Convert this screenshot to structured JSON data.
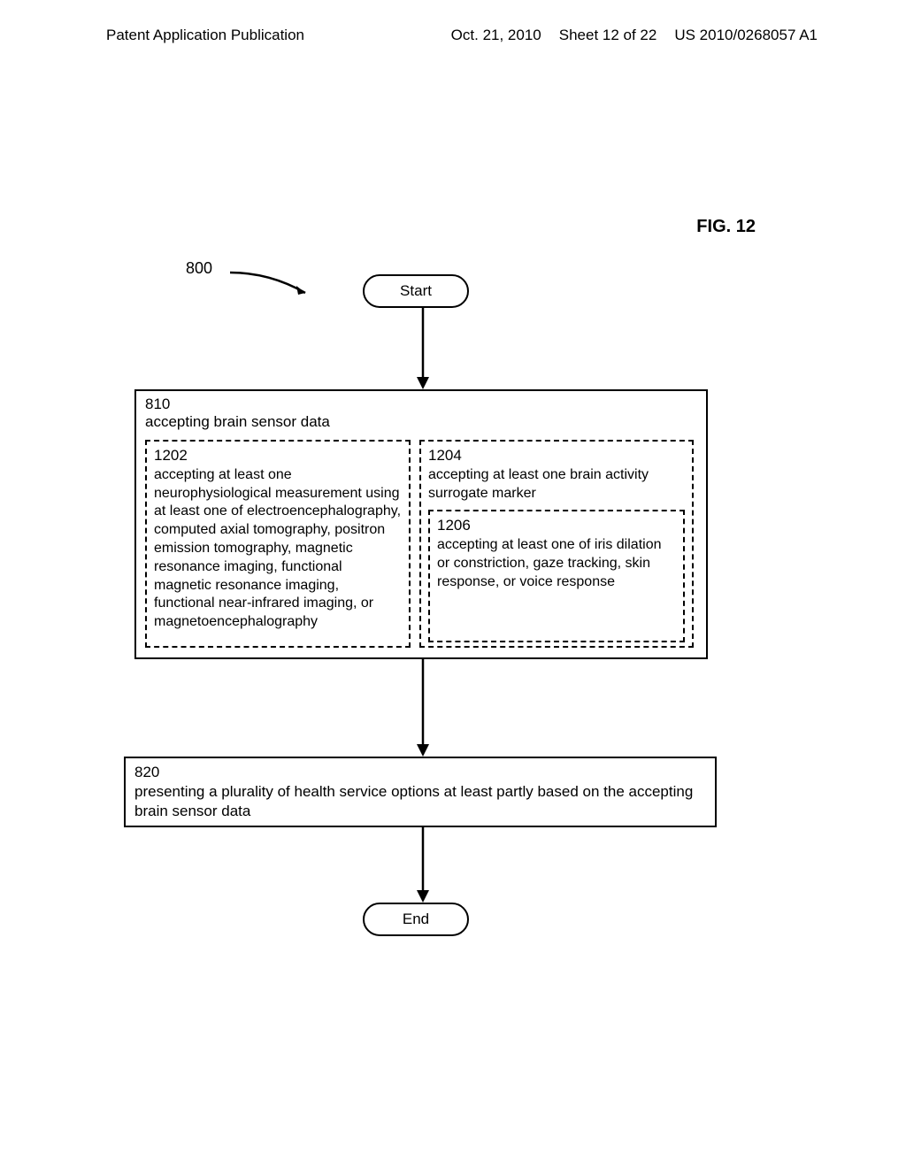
{
  "header": {
    "left": "Patent Application Publication",
    "date": "Oct. 21, 2010",
    "sheet": "Sheet 12 of 22",
    "pubnum": "US 2010/0268057 A1"
  },
  "figure": {
    "label": "FIG. 12",
    "ref800": "800",
    "start": "Start",
    "end": "End",
    "box810": {
      "num": "810",
      "text": "accepting brain sensor data"
    },
    "box1202": {
      "num": "1202",
      "text": "accepting at least one neurophysiological measurement using at least one of electroencephalography, computed axial tomography, positron emission tomography, magnetic resonance imaging, functional magnetic resonance imaging, functional near-infrared imaging, or magnetoencephalography"
    },
    "box1204": {
      "num": "1204",
      "text": "accepting at least one brain activity surrogate marker"
    },
    "box1206": {
      "num": "1206",
      "text": "accepting at least one of iris dilation or constriction, gaze tracking, skin response, or voice response"
    },
    "box820": {
      "num": "820",
      "text": "presenting a plurality of health service options at least partly based on the accepting brain sensor data"
    }
  }
}
